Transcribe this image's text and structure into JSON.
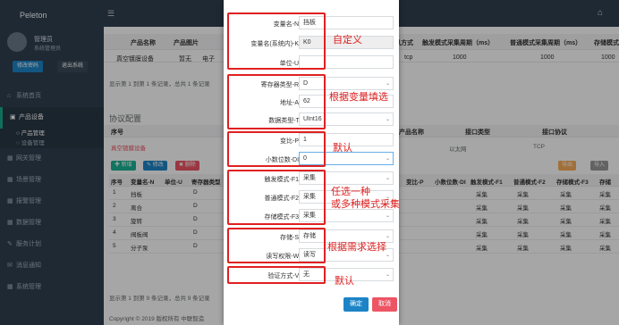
{
  "topbar": {
    "logo": "Peleton",
    "menu_icon": "bars-icon",
    "home_icon": "home-icon",
    "accent_colors": [
      "#1ab394",
      "#f8ac59",
      "#ed5565",
      "#23c6c8"
    ]
  },
  "sidebar": {
    "user_name": "管理员",
    "user_role": "系统管理员",
    "btn_primary": "修改密码",
    "btn_secondary": "退出系统",
    "nav": [
      {
        "label": "系统首页",
        "icon": "home-icon",
        "active": false
      },
      {
        "label": "产品设备",
        "icon": "folder-icon",
        "active": true
      },
      {
        "label": "网关管理",
        "icon": "grid-icon",
        "active": false
      },
      {
        "label": "场景管理",
        "icon": "grid-icon",
        "active": false
      },
      {
        "label": "报警管理",
        "icon": "grid-icon",
        "active": false
      },
      {
        "label": "数据管理",
        "icon": "grid-icon",
        "active": false
      },
      {
        "label": "服务计划",
        "icon": "wrench-icon",
        "active": false
      },
      {
        "label": "消息通知",
        "icon": "message-icon",
        "active": false
      },
      {
        "label": "系统管理",
        "icon": "grid-icon",
        "active": false
      }
    ],
    "sub_nav": [
      {
        "label": "产品管理",
        "active": true
      },
      {
        "label": "设备管理",
        "active": false
      }
    ]
  },
  "main": {
    "product_table": {
      "headers": [
        "产品名称",
        "产品图片",
        "产品类型",
        "通讯方式",
        "触发模式采集周期（ms）",
        "普通模式采集周期（ms）",
        "存储模式"
      ],
      "row": [
        "真空镀膜设备",
        "暂无",
        "电子",
        "tcp",
        "1000",
        "1000",
        "1000"
      ]
    },
    "pager_note_1": "显示第 1 到第 1 条记录，总共 1 条记录",
    "section_title": "协议配置",
    "protocol_headers": [
      "序号",
      "产品名称",
      "接口类型",
      "接口协议"
    ],
    "protocol_row": [
      "真空镀膜设备",
      "以太网",
      "TCP"
    ],
    "buttons": {
      "add": "新增",
      "edit": "修改",
      "delete": "删除",
      "export": "导出",
      "import": "导入"
    },
    "var_table": {
      "headers": [
        "序号",
        "变量名-N",
        "单位-U",
        "寄存器类型",
        "变比-P",
        "小数位数-DI",
        "触发模式-F1",
        "普通模式-F2",
        "存储模式-F3",
        "存储"
      ],
      "rows": [
        [
          "1",
          "挡板",
          "D",
          "1",
          "0",
          "采集",
          "采集",
          "采集",
          "采集"
        ],
        [
          "2",
          "离合",
          "D",
          "1",
          "0",
          "采集",
          "采集",
          "采集",
          "采集"
        ],
        [
          "3",
          "旋转",
          "D",
          "1",
          "0",
          "采集",
          "采集",
          "采集",
          "采集"
        ],
        [
          "4",
          "阀板阀",
          "D",
          "1",
          "0",
          "采集",
          "采集",
          "采集",
          "采集"
        ],
        [
          "5",
          "分子泵",
          "D",
          "1",
          "0",
          "采集",
          "采集",
          "采集",
          "采集"
        ]
      ]
    },
    "pager_note_2": "显示第 1 到第 9 条记录，总共 9 条记录",
    "footer": "Copyright © 2019 版权所有 中联智造"
  },
  "modal": {
    "fields": [
      {
        "label": "变量名-N:",
        "value": "挡板"
      },
      {
        "label": "变量名(系统内)-K:",
        "value": "K0"
      },
      {
        "label": "单位-U:",
        "value": ""
      },
      {
        "label": "寄存器类型-R:",
        "value": "D"
      },
      {
        "label": "地址-A:",
        "value": "62"
      },
      {
        "label": "数据类型-T:",
        "value": "UInt16"
      },
      {
        "label": "变比-P:",
        "value": "1"
      },
      {
        "label": "小数位数-DI:",
        "value": "0"
      },
      {
        "label": "触发模式-F1:",
        "value": "采集"
      },
      {
        "label": "普通模式-F2:",
        "value": "采集"
      },
      {
        "label": "存储模式-F3:",
        "value": "采集"
      },
      {
        "label": "存储-S:",
        "value": "存储"
      },
      {
        "label": "读写权限-W:",
        "value": "读写"
      },
      {
        "label": "验证方式-V:",
        "value": "无"
      }
    ],
    "ok": "确定",
    "cancel": "取消",
    "annotations": [
      "自定义",
      "根据变量填选",
      "默认",
      "任选一种\n或多种模式采集",
      "根据需求选择",
      "默认"
    ],
    "annotation_color": "#e02020"
  }
}
